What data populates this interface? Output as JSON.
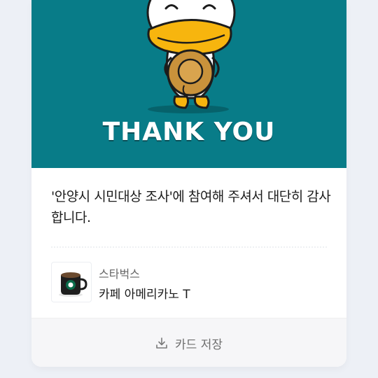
{
  "banner": {
    "headline": "THANK YOU"
  },
  "message": {
    "text": "'안양시 시민대상 조사'에 참여해 주셔서 대단히 감사합니다."
  },
  "product": {
    "brand": "스타벅스",
    "name": "카페 아메리카노 T",
    "icon": "starbucks-mug-icon"
  },
  "actions": {
    "save_label": "카드 저장",
    "save_icon": "download-icon"
  },
  "colors": {
    "banner_bg": "#087c88",
    "page_bg": "#edf0f6"
  }
}
